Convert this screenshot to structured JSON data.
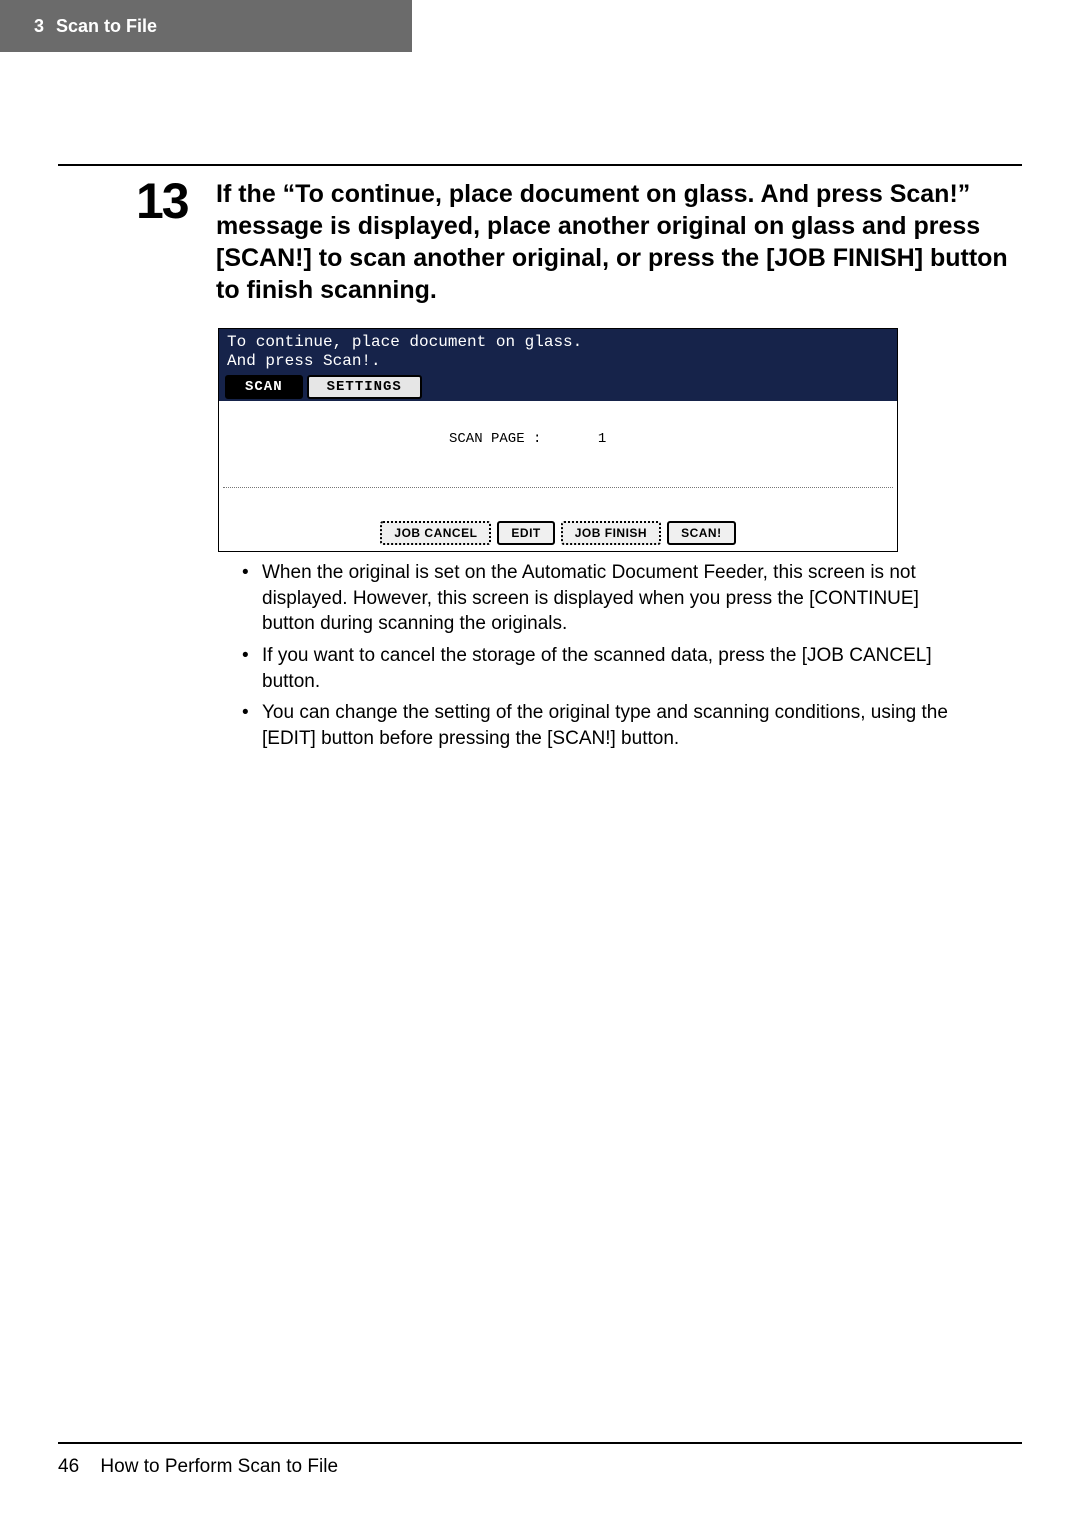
{
  "header": {
    "chapter_num": "3",
    "chapter_title": "Scan to File"
  },
  "step": {
    "number": "13",
    "text": "If the “To continue, place document on glass.  And press Scan!” message is displayed, place another original on glass and press [SCAN!] to scan another original, or press the [JOB FINISH] button to finish scanning."
  },
  "panel": {
    "msg_line1": "To continue, place document on glass.",
    "msg_line2": "And press Scan!.",
    "tabs": {
      "active": "SCAN",
      "inactive": "SETTINGS"
    },
    "body": {
      "scanpage_label": "SCAN PAGE :",
      "scanpage_value": "1"
    },
    "buttons": {
      "job_cancel": "JOB CANCEL",
      "edit": "EDIT",
      "job_finish": "JOB FINISH",
      "scan": "SCAN!"
    }
  },
  "bullets": [
    "When the original is set on the Automatic Document Feeder, this screen is not displayed.  However, this screen is displayed when you press the [CONTINUE] button during scanning the originals.",
    "If you want to cancel the storage of the scanned data, press the [JOB CANCEL] button.",
    "You can change the setting of the original type and scanning conditions, using the [EDIT] button before pressing the [SCAN!] button."
  ],
  "footer": {
    "page_number": "46",
    "running_title": "How to Perform Scan to File"
  }
}
